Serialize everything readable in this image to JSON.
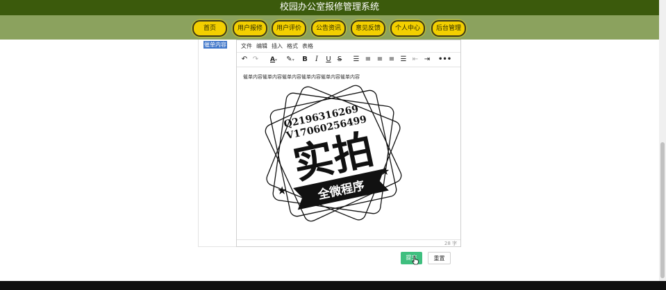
{
  "header": {
    "title": "校园办公室报修管理系统"
  },
  "nav": {
    "items": [
      {
        "label": "首页"
      },
      {
        "label": "用户报修"
      },
      {
        "label": "用户评价"
      },
      {
        "label": "公告资讯"
      },
      {
        "label": "意见反馈"
      },
      {
        "label": "个人中心"
      },
      {
        "label": "后台管理"
      }
    ]
  },
  "form": {
    "field_label": "催单内容",
    "editor": {
      "menus": [
        "文件",
        "编辑",
        "插入",
        "格式",
        "表格"
      ],
      "content_text": "催单内容催单内容催单内容催单内容催单内容催单内容",
      "word_count": "28 字"
    },
    "submit_label": "提交",
    "reset_label": "重置"
  },
  "image": {
    "line1": "Q2196316269",
    "line2": "V17060256499",
    "big_text": "实拍",
    "banner_text": "全微程序"
  },
  "colors": {
    "header_bg": "#3b5a0c",
    "nav_bg": "#8ba25e",
    "nav_button": "#f3cf00",
    "submit_bg": "#3fbf7f"
  }
}
